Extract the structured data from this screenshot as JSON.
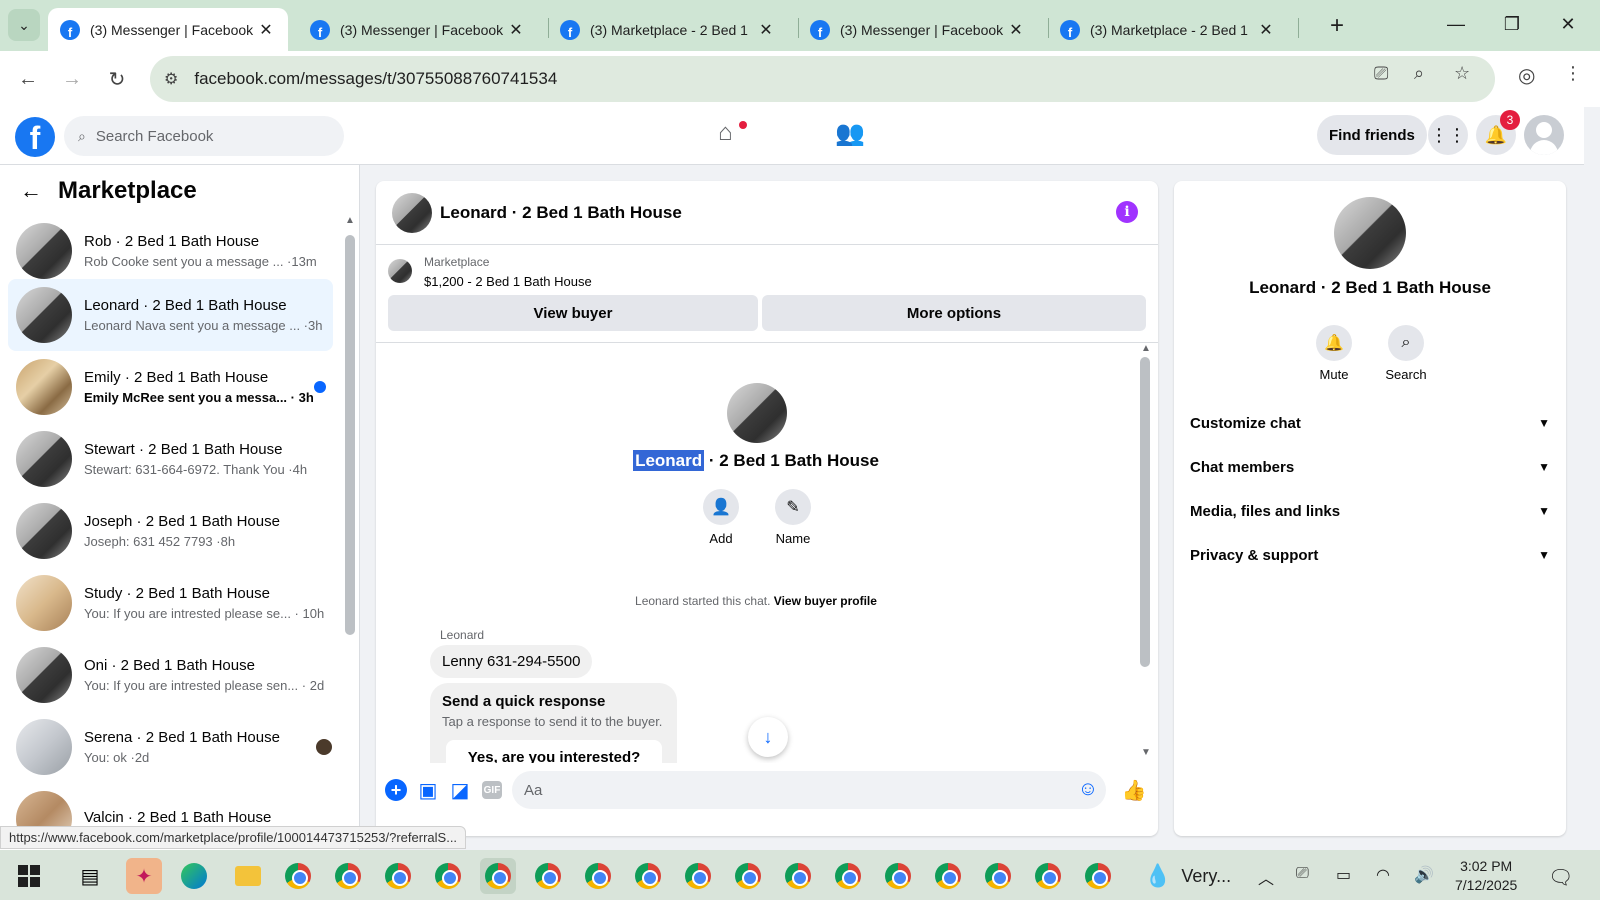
{
  "browser": {
    "tabs": [
      {
        "title": "(3) Messenger | Facebook",
        "active": true
      },
      {
        "title": "(3) Messenger | Facebook",
        "active": false
      },
      {
        "title": "(3) Marketplace - 2 Bed 1",
        "active": false
      },
      {
        "title": "(3) Messenger | Facebook",
        "active": false
      },
      {
        "title": "(3) Marketplace - 2 Bed 1",
        "active": false
      }
    ],
    "url": "facebook.com/messages/t/30755088760741534",
    "status_url": "https://www.facebook.com/marketplace/profile/100014473715253/?referralS..."
  },
  "fb_header": {
    "search_placeholder": "Search Facebook",
    "find_friends": "Find friends",
    "notification_count": "3"
  },
  "sidebar": {
    "title": "Marketplace",
    "conversations": [
      {
        "name": "Rob · 2 Bed 1 Bath House",
        "snippet": "Rob Cooke sent you a message ... ·13m",
        "unread": false
      },
      {
        "name": "Leonard · 2 Bed 1 Bath House",
        "snippet": "Leonard Nava sent you a message ... ·3h",
        "unread": false
      },
      {
        "name": "Emily · 2 Bed 1 Bath House",
        "snippet": "Emily McRee sent you a messa... · 3h",
        "unread": true
      },
      {
        "name": "Stewart · 2 Bed 1 Bath House",
        "snippet": "Stewart: 631-664-6972. Thank You ·4h",
        "unread": false
      },
      {
        "name": "Joseph · 2 Bed 1 Bath House",
        "snippet": "Joseph: 631 452 7793 ·8h",
        "unread": false
      },
      {
        "name": "Study · 2 Bed 1 Bath House",
        "snippet": "You: If you are intrested please se... · 10h",
        "unread": false
      },
      {
        "name": "Oni · 2 Bed 1 Bath House",
        "snippet": "You: If you are intrested please sen... · 2d",
        "unread": false
      },
      {
        "name": "Serena · 2 Bed 1 Bath House",
        "snippet": "You: ok ·2d",
        "unread": false
      },
      {
        "name": "Valcin · 2 Bed 1 Bath House",
        "snippet": "",
        "unread": false
      }
    ]
  },
  "chat": {
    "title": "Leonard · 2 Bed 1 Bath House",
    "marketplace_label": "Marketplace",
    "listing": "$1,200 - 2 Bed 1 Bath House",
    "view_buyer": "View buyer",
    "more_options": "More options",
    "thread_title_highlight": "Leonard",
    "thread_title_rest": " · 2 Bed 1 Bath House",
    "add_label": "Add",
    "name_label": "Name",
    "started_text": "Leonard started this chat.",
    "view_buyer_profile": "View buyer profile",
    "sender": "Leonard",
    "message": "Lenny 631-294-5500",
    "quick_title": "Send a quick response",
    "quick_sub": "Tap a response to send it to the buyer.",
    "quick_option": "Yes, are you interested?",
    "composer_placeholder": "Aa"
  },
  "info_panel": {
    "name": "Leonard · 2 Bed 1 Bath House",
    "mute": "Mute",
    "search": "Search",
    "sections": [
      "Customize chat",
      "Chat members",
      "Media, files and links",
      "Privacy & support"
    ]
  },
  "taskbar": {
    "weather": "Very...",
    "time": "3:02 PM",
    "date": "7/12/2025"
  },
  "colors": {
    "facebook_blue": "#1877f2",
    "messenger_blue": "#0866ff",
    "info_purple": "#a033ff",
    "notification_red": "#e41e3f"
  }
}
